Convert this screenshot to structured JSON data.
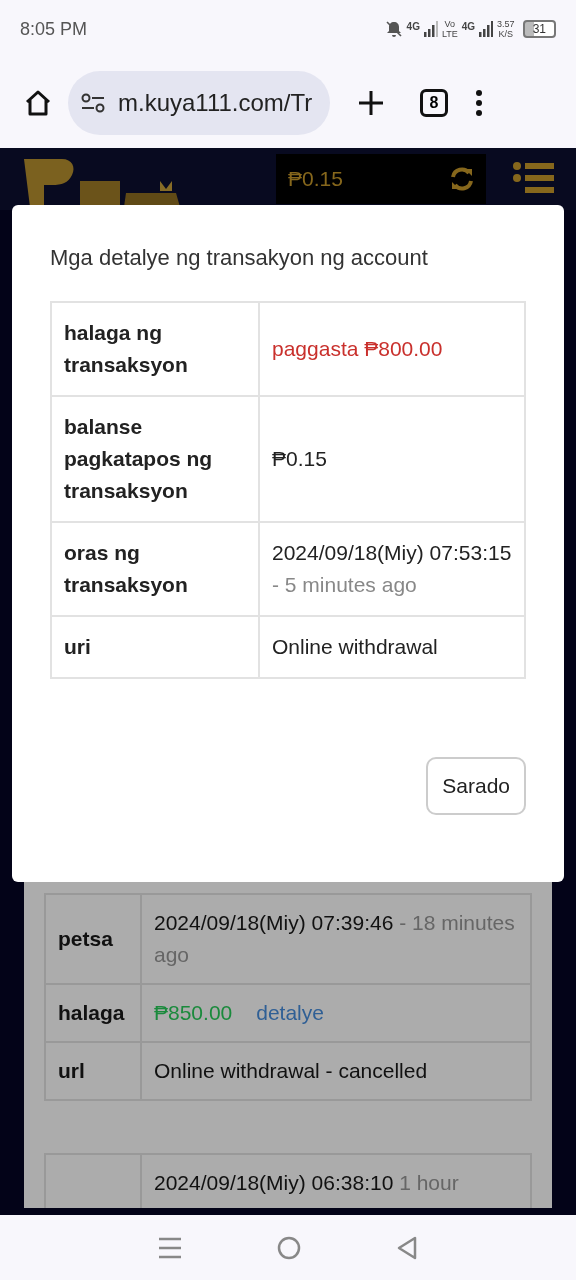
{
  "status_bar": {
    "time": "8:05 PM",
    "sim1": "4G",
    "volte_top": "Vo",
    "volte_bottom": "LTE",
    "sim2": "4G",
    "speed_value": "3.57",
    "speed_unit": "K/S",
    "battery": "31"
  },
  "browser": {
    "url": "m.kuya111.com/Tr",
    "tab_count": "8"
  },
  "site_header": {
    "balance": "₱0.15"
  },
  "background_records": [
    {
      "rows": [
        {
          "label": "petsa",
          "value": "2024/09/18(Miy) 07:39:46",
          "note": "- 18 minutes ago"
        },
        {
          "label": "halaga",
          "value": "₱850.00",
          "link": "detalye",
          "color": "#1a8a3c"
        },
        {
          "label": "url",
          "value": "Online withdrawal - cancelled"
        }
      ]
    },
    {
      "rows": [
        {
          "value": "2024/09/18(Miy) 06:38:10",
          "note": "1 hour"
        }
      ]
    }
  ],
  "modal": {
    "title": "Mga detalye ng transakyon ng account",
    "rows": [
      {
        "label": "halaga ng transaksyon",
        "value": "paggasta ₱800.00",
        "color": "#c9302c"
      },
      {
        "label": "balanse pagkatapos ng transaksyon",
        "value": "₱0.15"
      },
      {
        "label": "oras ng transaksyon",
        "value": "2024/09/18(Miy) 07:53:15",
        "note": "- 5 minutes ago"
      },
      {
        "label": "uri",
        "value": "Online withdrawal"
      }
    ],
    "close_button": "Sarado"
  }
}
